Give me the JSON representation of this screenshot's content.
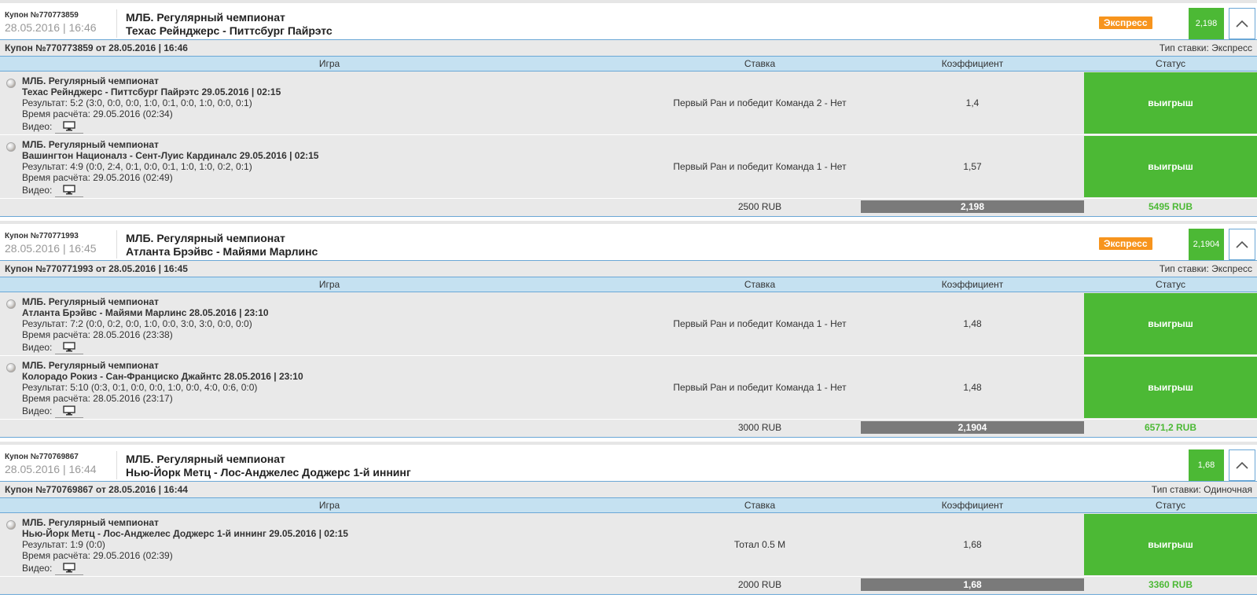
{
  "colors": {
    "win_green": "#4cb935",
    "express_orange": "#f7941d",
    "header_blue": "#c5e1f1",
    "total_gray": "#7a7a7a"
  },
  "icons": {
    "ball": "baseball-icon",
    "video": "monitor-icon",
    "collapse": "chevron-up-icon"
  },
  "table_headers": {
    "game": "Игра",
    "bet": "Ставка",
    "coef": "Коэффициент",
    "status": "Статус"
  },
  "coupons": [
    {
      "number": "Купон №770773859",
      "date": "28.05.2016 | 16:46",
      "league": "МЛБ. Регулярный чемпионат",
      "match": "Техас Рейнджерс - Питтсбург Пайрэтс",
      "badge": "Экспресс",
      "odds": "2,198",
      "info": "Купон №770773859 от 28.05.2016 | 16:46",
      "bet_type": "Тип ставки: Экспресс",
      "rows": [
        {
          "league": "МЛБ. Регулярный чемпионат",
          "match": "Техас Рейнджерс - Питтсбург Пайрэтс 29.05.2016 | 02:15",
          "result": "Результат: 5:2 (3:0, 0:0, 0:0, 1:0, 0:1, 0:0, 1:0, 0:0, 0:1)",
          "calc_time": "Время расчёта: 29.05.2016 (02:34)",
          "video": "Видео:",
          "bet": "Первый Ран и победит Команда 2 - Нет",
          "coef": "1,4",
          "status": "выигрыш"
        },
        {
          "league": "МЛБ. Регулярный чемпионат",
          "match": "Вашингтон Националз - Сент-Луис Кардиналс 29.05.2016 | 02:15",
          "result": "Результат: 4:9 (0:0, 2:4, 0:1, 0:0, 0:1, 1:0, 1:0, 0:2, 0:1)",
          "calc_time": "Время расчёта: 29.05.2016 (02:49)",
          "video": "Видео:",
          "bet": "Первый Ран и победит Команда 1 - Нет",
          "coef": "1,57",
          "status": "выигрыш"
        }
      ],
      "stake": "2500 RUB",
      "total_coef": "2,198",
      "win": "5495 RUB"
    },
    {
      "number": "Купон №770771993",
      "date": "28.05.2016 | 16:45",
      "league": "МЛБ. Регулярный чемпионат",
      "match": "Атланта Брэйвс - Майями Марлинс",
      "badge": "Экспресс",
      "odds": "2,1904",
      "info": "Купон №770771993 от 28.05.2016 | 16:45",
      "bet_type": "Тип ставки: Экспресс",
      "rows": [
        {
          "league": "МЛБ. Регулярный чемпионат",
          "match": "Атланта Брэйвс - Майями Марлинс 28.05.2016 | 23:10",
          "result": "Результат: 7:2 (0:0, 0:2, 0:0, 1:0, 0:0, 3:0, 3:0, 0:0, 0:0)",
          "calc_time": "Время расчёта: 28.05.2016 (23:38)",
          "video": "Видео:",
          "bet": "Первый Ран и победит Команда 1 - Нет",
          "coef": "1,48",
          "status": "выигрыш"
        },
        {
          "league": "МЛБ. Регулярный чемпионат",
          "match": "Колорадо Рокиз - Сан-Франциско Джайнтс 28.05.2016 | 23:10",
          "result": "Результат: 5:10 (0:3, 0:1, 0:0, 0:0, 1:0, 0:0, 4:0, 0:6, 0:0)",
          "calc_time": "Время расчёта: 28.05.2016 (23:17)",
          "video": "Видео:",
          "bet": "Первый Ран и победит Команда 1 - Нет",
          "coef": "1,48",
          "status": "выигрыш"
        }
      ],
      "stake": "3000 RUB",
      "total_coef": "2,1904",
      "win": "6571,2 RUB"
    },
    {
      "number": "Купон №770769867",
      "date": "28.05.2016 | 16:44",
      "league": "МЛБ. Регулярный чемпионат",
      "match": "Нью-Йорк Метц - Лос-Анджелес Доджерс 1-й иннинг",
      "badge": "",
      "odds": "1,68",
      "info": "Купон №770769867 от 28.05.2016 | 16:44",
      "bet_type": "Тип ставки: Одиночная",
      "rows": [
        {
          "league": "МЛБ. Регулярный чемпионат",
          "match": "Нью-Йорк Метц - Лос-Анджелес Доджерс 1-й иннинг 29.05.2016 | 02:15",
          "result": "Результат: 1:9 (0:0)",
          "calc_time": "Время расчёта: 29.05.2016 (02:39)",
          "video": "Видео:",
          "bet": "Тотал 0.5 М",
          "coef": "1,68",
          "status": "выигрыш"
        }
      ],
      "stake": "2000 RUB",
      "total_coef": "1,68",
      "win": "3360 RUB"
    }
  ]
}
